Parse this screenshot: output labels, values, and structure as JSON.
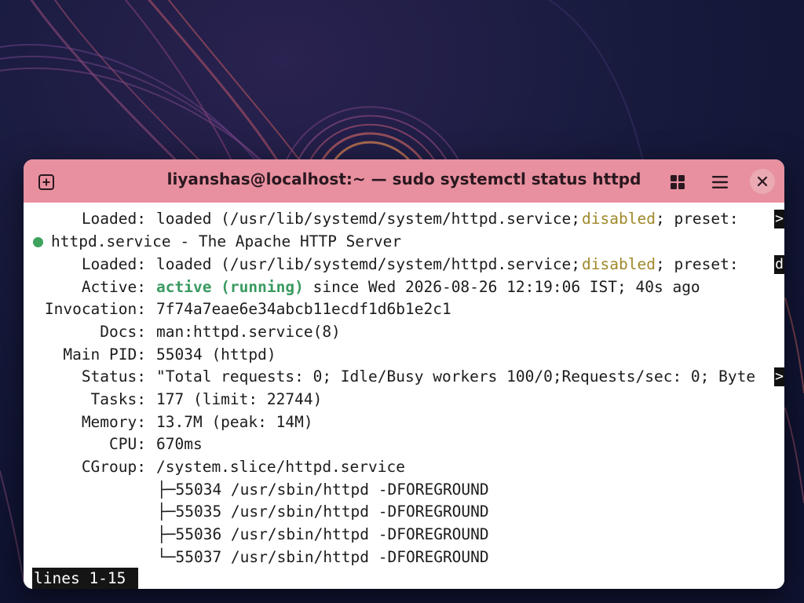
{
  "window": {
    "title": "liyanshas@localhost:~ — sudo systemctl status httpd"
  },
  "icons": {
    "new_tab": "new-tab-icon",
    "grid": "grid-view-icon",
    "menu": "hamburger-menu-icon",
    "close": "close-icon"
  },
  "colors": {
    "titlebar": "#e8909f",
    "active_green": "#3a9a61",
    "disabled_yellow": "#a0882a",
    "status_dot": "#3ea35d"
  },
  "terminal": {
    "loaded_top": {
      "label": "Loaded:",
      "pre": "loaded (/usr/lib/systemd/system/httpd.service;",
      "state": "disabled",
      "post": "; preset:",
      "cursor": ">"
    },
    "service_header": {
      "text": "httpd.service - The Apache HTTP Server"
    },
    "loaded": {
      "label": "Loaded:",
      "pre": "loaded (/usr/lib/systemd/system/httpd.service;",
      "state": "disabled",
      "post": "; preset:",
      "cursor": "d"
    },
    "active": {
      "label": "Active:",
      "state": "active (running)",
      "since": "since Wed 2026-08-26 12:19:06 IST; 40s ago"
    },
    "invocation": {
      "label": "Invocation:",
      "value": "7f74a7eae6e34abcb11ecdf1d6b1e2c1"
    },
    "docs": {
      "label": "Docs:",
      "value": "man:httpd.service(8)"
    },
    "main_pid": {
      "label": "Main PID:",
      "value": "55034 (httpd)"
    },
    "status": {
      "label": "Status:",
      "value": "\"Total requests: 0; Idle/Busy workers 100/0;Requests/sec: 0; Byte",
      "cursor": ">"
    },
    "tasks": {
      "label": "Tasks:",
      "value": "177 (limit: 22744)"
    },
    "memory": {
      "label": "Memory:",
      "value": "13.7M (peak: 14M)"
    },
    "cpu": {
      "label": "CPU:",
      "value": "670ms"
    },
    "cgroup": {
      "label": "CGroup:",
      "value": "/system.slice/httpd.service"
    },
    "processes": [
      "├─55034 /usr/sbin/httpd -DFOREGROUND",
      "├─55035 /usr/sbin/httpd -DFOREGROUND",
      "├─55036 /usr/sbin/httpd -DFOREGROUND",
      "└─55037 /usr/sbin/httpd -DFOREGROUND"
    ],
    "pager_status": "lines 1-15"
  }
}
